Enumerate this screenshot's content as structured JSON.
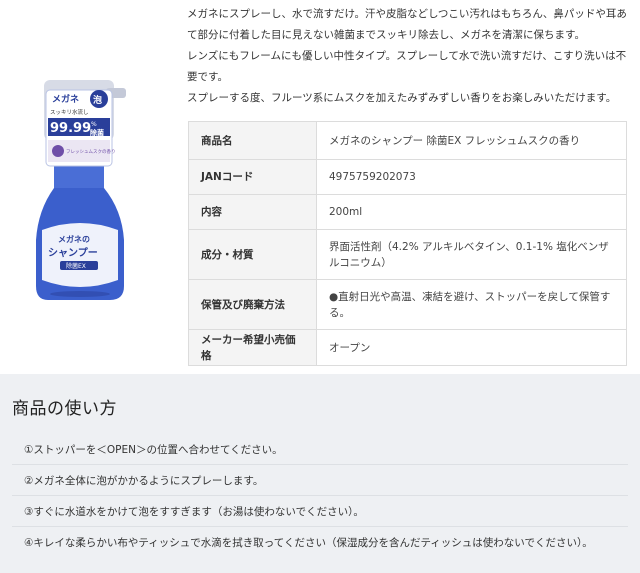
{
  "description": [
    "メガネにスプレーし、水で流すだけ。汗や皮脂などしつこい汚れはもちろん、鼻パッドや耳あて部分に付着した目に見えない雑菌までスッキリ除去し、メガネを清潔に保ちます。",
    "レンズにもフレームにも優しい中性タイプ。スプレーして水で洗い流すだけ、こすり洗いは不要です。",
    "スプレーする度、フルーツ系にムスクを加えたみずみずしい香りをお楽しみいただけます。"
  ],
  "product_image": {
    "label_top": "メガネ",
    "label_foam": "泡",
    "label_sub": "スッキリ水流し",
    "percent": "99.99",
    "percent_unit": "%",
    "label_kill": "除菌",
    "label_scent": "フレッシュムスクの香り",
    "brand_main_1": "メガネの",
    "brand_main_2": "シャンプー",
    "brand_sub": "除菌EX",
    "colors": {
      "cap": "#d7dbe6",
      "bottle": "#3b5fcc",
      "bottle_dark": "#2a3f9a",
      "label": "#ffffff",
      "accent": "#6f4fa8"
    }
  },
  "spec_table": [
    {
      "key": "商品名",
      "value": "メガネのシャンプー 除菌EX フレッシュムスクの香り"
    },
    {
      "key": "JANコード",
      "value": "4975759202073"
    },
    {
      "key": "内容",
      "value": "200ml"
    },
    {
      "key": "成分・材質",
      "value": "界面活性剤（4.2% アルキルベタイン、0.1-1% 塩化ベンザルコニウム）"
    },
    {
      "key": "保管及び廃棄方法",
      "value": "●直射日光や高温、凍結を避け、ストッパーを戻して保管する。"
    },
    {
      "key": "メーカー希望小売価格",
      "value": "オープン"
    }
  ],
  "usage": {
    "title": "商品の使い方",
    "steps": [
      "①ストッパーを＜OPEN＞の位置へ合わせてください。",
      "②メガネ全体に泡がかかるようにスプレーします。",
      "③すぐに水道水をかけて泡をすすぎます（お湯は使わないでください）。",
      "④キレイな柔らかい布やティッシュで水滴を拭き取ってください（保湿成分を含んだティッシュは使わないでください）。"
    ]
  }
}
